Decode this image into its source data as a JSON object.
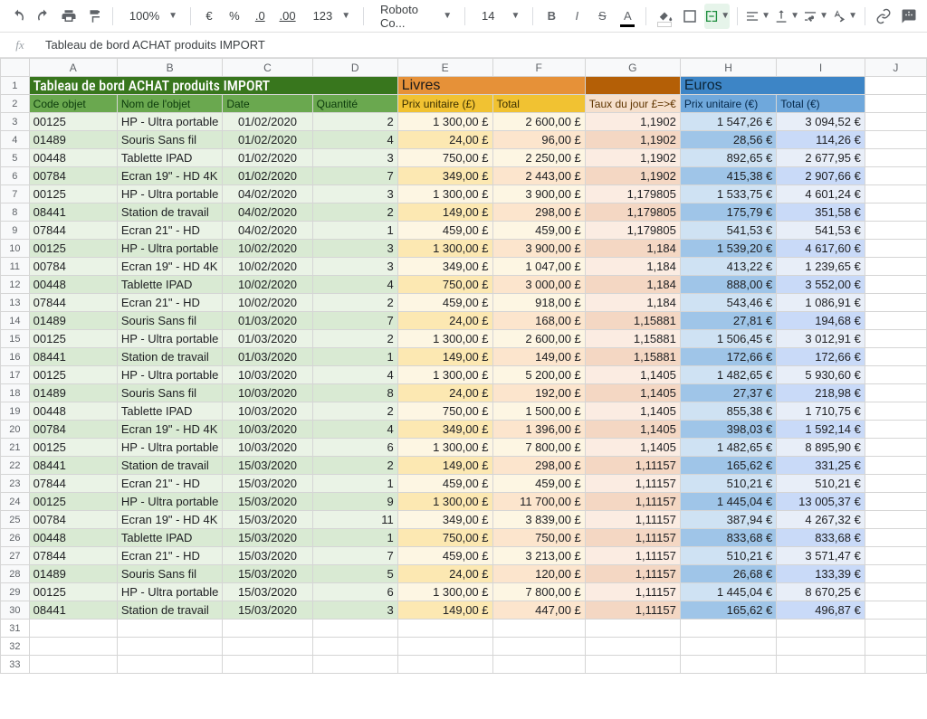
{
  "toolbar": {
    "zoom": "100%",
    "currency": "€",
    "percent": "%",
    "dec_dec": ".0",
    "dec_inc": ".00",
    "numfmt": "123",
    "font": "Roboto Co...",
    "font_size": "14"
  },
  "formula_bar": {
    "fx": "fx",
    "content": "Tableau de bord ACHAT produits IMPORT"
  },
  "columns": [
    "A",
    "B",
    "C",
    "D",
    "E",
    "F",
    "G",
    "H",
    "I",
    "J"
  ],
  "section_titles": {
    "main": "Tableau de bord ACHAT produits IMPORT",
    "livres": "Livres",
    "euros": "Euros"
  },
  "headers": {
    "code": "Code objet",
    "nom": "Nom de l'objet",
    "date": "Date",
    "qte": "Quantité",
    "prix_l": "Prix unitaire (£)",
    "total_l": "Total",
    "taux": "Taux du jour £=>€",
    "prix_e": "Prix unitaire (€)",
    "total_e": "Total (€)"
  },
  "rows": [
    {
      "n": 3,
      "code": "00125",
      "nom": "HP - Ultra portable",
      "date": "01/02/2020",
      "qte": "2",
      "pl": "1 300,00 £",
      "tl": "2 600,00 £",
      "tx": "1,1902",
      "pe": "1 547,26 €",
      "te": "3 094,52 €"
    },
    {
      "n": 4,
      "code": "01489",
      "nom": "Souris Sans fil",
      "date": "01/02/2020",
      "qte": "4",
      "pl": "24,00 £",
      "tl": "96,00 £",
      "tx": "1,1902",
      "pe": "28,56 €",
      "te": "114,26 €"
    },
    {
      "n": 5,
      "code": "00448",
      "nom": "Tablette IPAD",
      "date": "01/02/2020",
      "qte": "3",
      "pl": "750,00 £",
      "tl": "2 250,00 £",
      "tx": "1,1902",
      "pe": "892,65 €",
      "te": "2 677,95 €"
    },
    {
      "n": 6,
      "code": "00784",
      "nom": "Ecran 19\" - HD 4K",
      "date": "01/02/2020",
      "qte": "7",
      "pl": "349,00 £",
      "tl": "2 443,00 £",
      "tx": "1,1902",
      "pe": "415,38 €",
      "te": "2 907,66 €"
    },
    {
      "n": 7,
      "code": "00125",
      "nom": "HP - Ultra portable",
      "date": "04/02/2020",
      "qte": "3",
      "pl": "1 300,00 £",
      "tl": "3 900,00 £",
      "tx": "1,179805",
      "pe": "1 533,75 €",
      "te": "4 601,24 €"
    },
    {
      "n": 8,
      "code": "08441",
      "nom": "Station de travail",
      "date": "04/02/2020",
      "qte": "2",
      "pl": "149,00 £",
      "tl": "298,00 £",
      "tx": "1,179805",
      "pe": "175,79 €",
      "te": "351,58 €"
    },
    {
      "n": 9,
      "code": "07844",
      "nom": "Ecran 21\" - HD",
      "date": "04/02/2020",
      "qte": "1",
      "pl": "459,00 £",
      "tl": "459,00 £",
      "tx": "1,179805",
      "pe": "541,53 €",
      "te": "541,53 €"
    },
    {
      "n": 10,
      "code": "00125",
      "nom": "HP - Ultra portable",
      "date": "10/02/2020",
      "qte": "3",
      "pl": "1 300,00 £",
      "tl": "3 900,00 £",
      "tx": "1,184",
      "pe": "1 539,20 €",
      "te": "4 617,60 €"
    },
    {
      "n": 11,
      "code": "00784",
      "nom": "Ecran 19\" - HD 4K",
      "date": "10/02/2020",
      "qte": "3",
      "pl": "349,00 £",
      "tl": "1 047,00 £",
      "tx": "1,184",
      "pe": "413,22 €",
      "te": "1 239,65 €"
    },
    {
      "n": 12,
      "code": "00448",
      "nom": "Tablette IPAD",
      "date": "10/02/2020",
      "qte": "4",
      "pl": "750,00 £",
      "tl": "3 000,00 £",
      "tx": "1,184",
      "pe": "888,00 €",
      "te": "3 552,00 €"
    },
    {
      "n": 13,
      "code": "07844",
      "nom": "Ecran 21\" - HD",
      "date": "10/02/2020",
      "qte": "2",
      "pl": "459,00 £",
      "tl": "918,00 £",
      "tx": "1,184",
      "pe": "543,46 €",
      "te": "1 086,91 €"
    },
    {
      "n": 14,
      "code": "01489",
      "nom": "Souris Sans fil",
      "date": "01/03/2020",
      "qte": "7",
      "pl": "24,00 £",
      "tl": "168,00 £",
      "tx": "1,15881",
      "pe": "27,81 €",
      "te": "194,68 €"
    },
    {
      "n": 15,
      "code": "00125",
      "nom": "HP - Ultra portable",
      "date": "01/03/2020",
      "qte": "2",
      "pl": "1 300,00 £",
      "tl": "2 600,00 £",
      "tx": "1,15881",
      "pe": "1 506,45 €",
      "te": "3 012,91 €"
    },
    {
      "n": 16,
      "code": "08441",
      "nom": "Station de travail",
      "date": "01/03/2020",
      "qte": "1",
      "pl": "149,00 £",
      "tl": "149,00 £",
      "tx": "1,15881",
      "pe": "172,66 €",
      "te": "172,66 €"
    },
    {
      "n": 17,
      "code": "00125",
      "nom": "HP - Ultra portable",
      "date": "10/03/2020",
      "qte": "4",
      "pl": "1 300,00 £",
      "tl": "5 200,00 £",
      "tx": "1,1405",
      "pe": "1 482,65 €",
      "te": "5 930,60 €"
    },
    {
      "n": 18,
      "code": "01489",
      "nom": "Souris Sans fil",
      "date": "10/03/2020",
      "qte": "8",
      "pl": "24,00 £",
      "tl": "192,00 £",
      "tx": "1,1405",
      "pe": "27,37 €",
      "te": "218,98 €"
    },
    {
      "n": 19,
      "code": "00448",
      "nom": "Tablette IPAD",
      "date": "10/03/2020",
      "qte": "2",
      "pl": "750,00 £",
      "tl": "1 500,00 £",
      "tx": "1,1405",
      "pe": "855,38 €",
      "te": "1 710,75 €"
    },
    {
      "n": 20,
      "code": "00784",
      "nom": "Ecran 19\" - HD 4K",
      "date": "10/03/2020",
      "qte": "4",
      "pl": "349,00 £",
      "tl": "1 396,00 £",
      "tx": "1,1405",
      "pe": "398,03 €",
      "te": "1 592,14 €"
    },
    {
      "n": 21,
      "code": "00125",
      "nom": "HP - Ultra portable",
      "date": "10/03/2020",
      "qte": "6",
      "pl": "1 300,00 £",
      "tl": "7 800,00 £",
      "tx": "1,1405",
      "pe": "1 482,65 €",
      "te": "8 895,90 €"
    },
    {
      "n": 22,
      "code": "08441",
      "nom": "Station de travail",
      "date": "15/03/2020",
      "qte": "2",
      "pl": "149,00 £",
      "tl": "298,00 £",
      "tx": "1,11157",
      "pe": "165,62 €",
      "te": "331,25 €"
    },
    {
      "n": 23,
      "code": "07844",
      "nom": "Ecran 21\" - HD",
      "date": "15/03/2020",
      "qte": "1",
      "pl": "459,00 £",
      "tl": "459,00 £",
      "tx": "1,11157",
      "pe": "510,21 €",
      "te": "510,21 €"
    },
    {
      "n": 24,
      "code": "00125",
      "nom": "HP - Ultra portable",
      "date": "15/03/2020",
      "qte": "9",
      "pl": "1 300,00 £",
      "tl": "11 700,00 £",
      "tx": "1,11157",
      "pe": "1 445,04 €",
      "te": "13 005,37 €"
    },
    {
      "n": 25,
      "code": "00784",
      "nom": "Ecran 19\" - HD 4K",
      "date": "15/03/2020",
      "qte": "11",
      "pl": "349,00 £",
      "tl": "3 839,00 £",
      "tx": "1,11157",
      "pe": "387,94 €",
      "te": "4 267,32 €"
    },
    {
      "n": 26,
      "code": "00448",
      "nom": "Tablette IPAD",
      "date": "15/03/2020",
      "qte": "1",
      "pl": "750,00 £",
      "tl": "750,00 £",
      "tx": "1,11157",
      "pe": "833,68 €",
      "te": "833,68 €"
    },
    {
      "n": 27,
      "code": "07844",
      "nom": "Ecran 21\" - HD",
      "date": "15/03/2020",
      "qte": "7",
      "pl": "459,00 £",
      "tl": "3 213,00 £",
      "tx": "1,11157",
      "pe": "510,21 €",
      "te": "3 571,47 €"
    },
    {
      "n": 28,
      "code": "01489",
      "nom": "Souris Sans fil",
      "date": "15/03/2020",
      "qte": "5",
      "pl": "24,00 £",
      "tl": "120,00 £",
      "tx": "1,11157",
      "pe": "26,68 €",
      "te": "133,39 €"
    },
    {
      "n": 29,
      "code": "00125",
      "nom": "HP - Ultra portable",
      "date": "15/03/2020",
      "qte": "6",
      "pl": "1 300,00 £",
      "tl": "7 800,00 £",
      "tx": "1,11157",
      "pe": "1 445,04 €",
      "te": "8 670,25 €"
    },
    {
      "n": 30,
      "code": "08441",
      "nom": "Station de travail",
      "date": "15/03/2020",
      "qte": "3",
      "pl": "149,00 £",
      "tl": "447,00 £",
      "tx": "1,11157",
      "pe": "165,62 €",
      "te": "496,87 €"
    }
  ],
  "empty_rows": [
    31,
    32,
    33
  ]
}
